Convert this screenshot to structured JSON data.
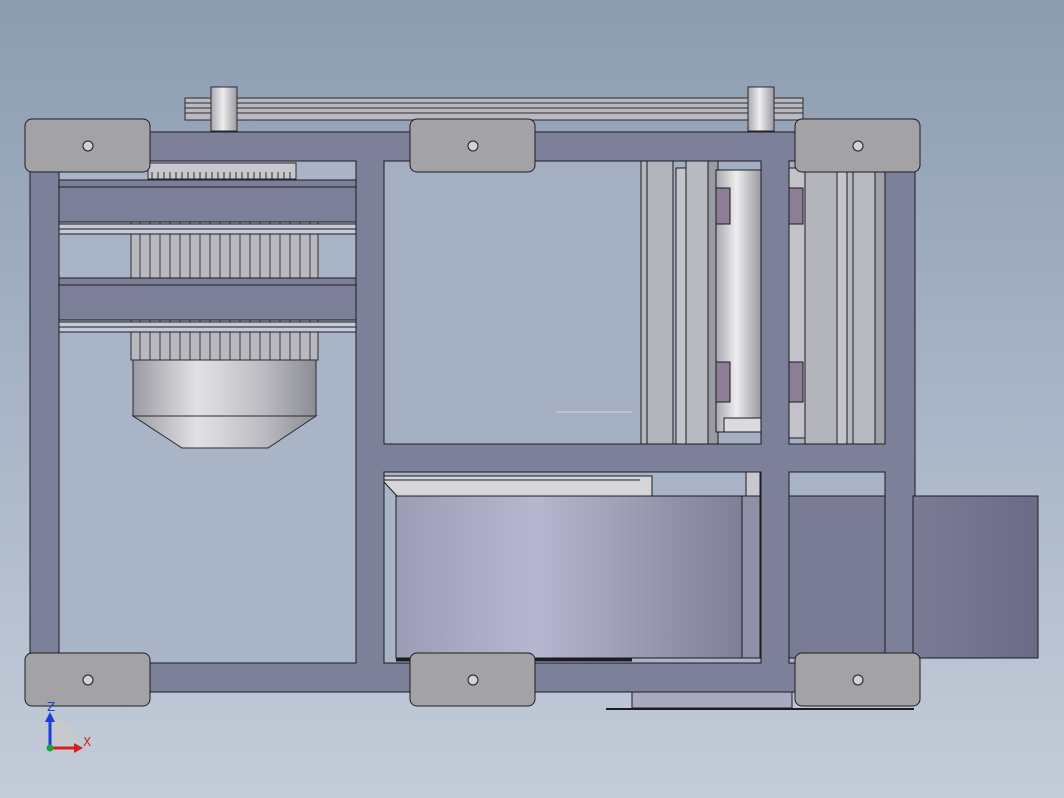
{
  "viewport": {
    "background_top": "#8d9cb0",
    "background_bottom": "#c4ccd8"
  },
  "model": {
    "frame_color": "#7c8199",
    "pad_color": "#a3a3a5",
    "outline_color": "#1b1b22",
    "motor_color": "#b4b4c4",
    "edge_color": "#3a3a44"
  },
  "triad": {
    "z_label": "Z",
    "x_label": "X",
    "z_color": "#1a3fd8",
    "x_color": "#d62020",
    "y_color": "#23a23a"
  }
}
